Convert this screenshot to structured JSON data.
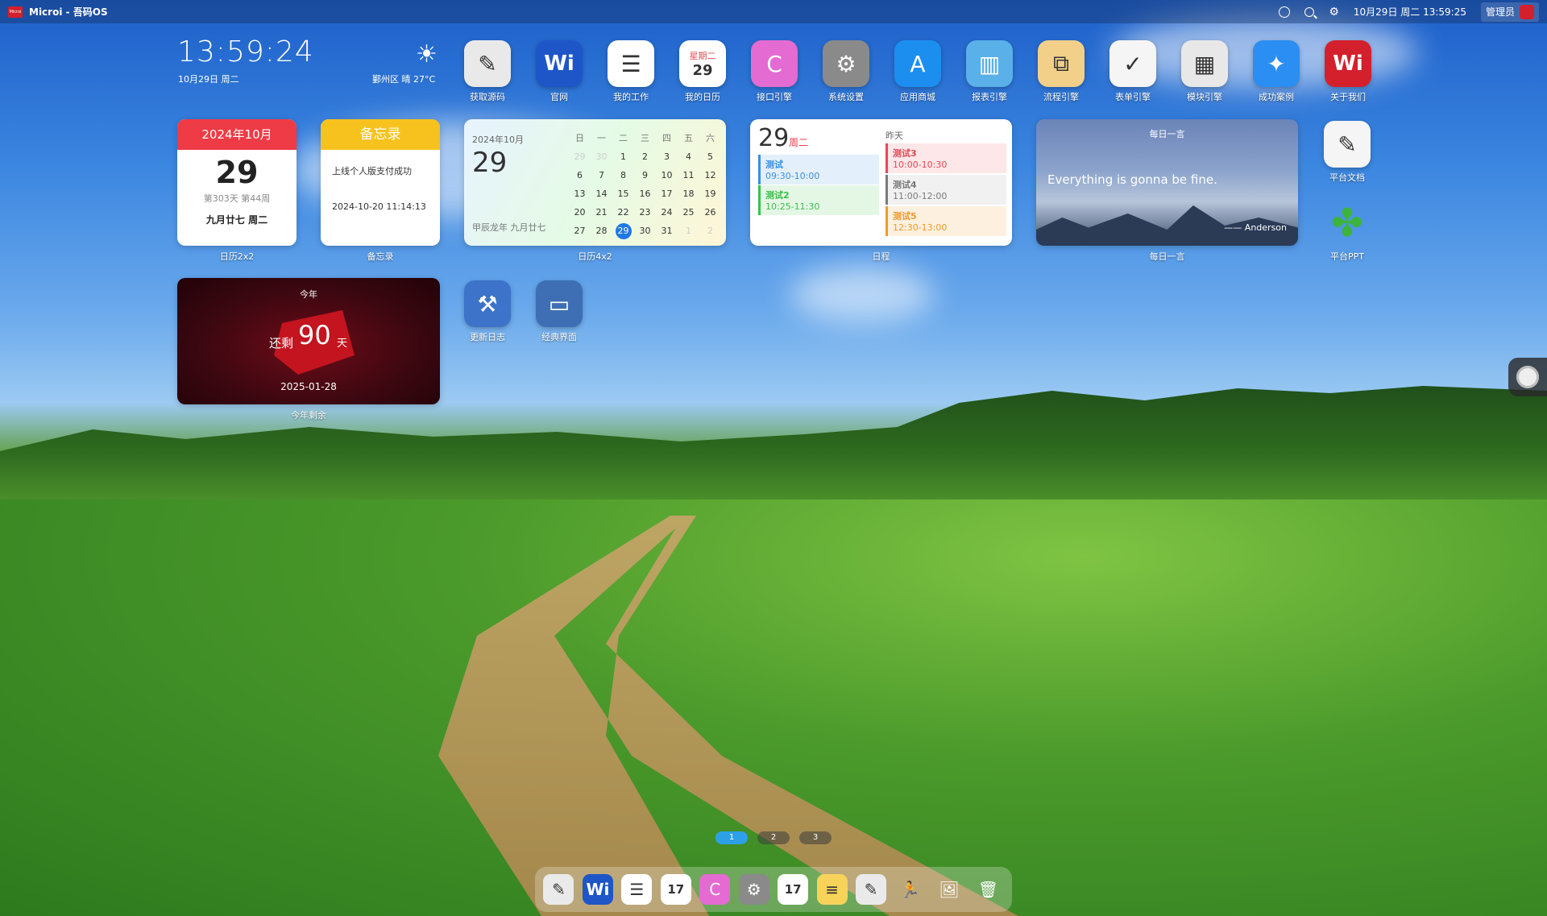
{
  "menubar": {
    "app_title": "Microi - 吾码OS",
    "datetime": "10月29日 周二 13:59:25",
    "user": "管理员"
  },
  "clock": {
    "time": "13:59:24",
    "date": "10月29日 周二"
  },
  "weather": {
    "text": "鄞州区 晴 27°C",
    "icon": "sun-icon"
  },
  "desktop_icons": [
    {
      "label": "获取源码",
      "icon": "pen-icon",
      "color": "#e9e9e9"
    },
    {
      "label": "官网",
      "icon": "wi-logo-icon",
      "color": "#1e56c8"
    },
    {
      "label": "我的工作",
      "icon": "list-icon",
      "color": "#ffffff"
    },
    {
      "label": "我的日历",
      "icon": "calendar-icon",
      "color": "#ffffff",
      "cal_weekday": "星期二",
      "cal_day": "29"
    },
    {
      "label": "接口引擎",
      "icon": "api-icon",
      "color": "#e36bd1"
    },
    {
      "label": "系统设置",
      "icon": "gear-icon",
      "color": "#8a8a8a"
    },
    {
      "label": "应用商城",
      "icon": "appstore-icon",
      "color": "#1b8ef0"
    },
    {
      "label": "报表引擎",
      "icon": "report-icon",
      "color": "#5ab0e8"
    },
    {
      "label": "流程引擎",
      "icon": "flow-icon",
      "color": "#f2d08a"
    },
    {
      "label": "表单引擎",
      "icon": "form-icon",
      "color": "#f5f5f5"
    },
    {
      "label": "模块引擎",
      "icon": "grid-icon",
      "color": "#e8e8e8"
    },
    {
      "label": "成功案例",
      "icon": "compass-icon",
      "color": "#2a8ef2"
    },
    {
      "label": "关于我们",
      "icon": "wi-logo-icon",
      "color": "#d4202c"
    }
  ],
  "side_icons": [
    {
      "label": "平台文档",
      "icon": "doc-icon",
      "color": "#f5f5f5"
    },
    {
      "label": "平台PPT",
      "icon": "clover-icon",
      "color": "transparent"
    }
  ],
  "row_icons": [
    {
      "label": "更新日志",
      "icon": "xcode-icon",
      "color": "#3d73c9"
    },
    {
      "label": "经典界面",
      "icon": "window-icon",
      "color": "#3e6fb5"
    }
  ],
  "widgets": {
    "cal2x2": {
      "month": "2024年10月",
      "day": "29",
      "sub": "第303天 第44周",
      "lunar": "九月廿七 周二",
      "label": "日历2x2"
    },
    "memo": {
      "header": "备忘录",
      "text": "上线个人版支付成功",
      "time": "2024-10-20 11:14:13",
      "label": "备忘录"
    },
    "cal4x2": {
      "ym": "2024年10月",
      "day": "29",
      "lunar": "甲辰龙年 九月廿七",
      "label": "日历4x2",
      "weekdays": [
        "日",
        "一",
        "二",
        "三",
        "四",
        "五",
        "六"
      ],
      "weeks": [
        [
          "29",
          "30",
          "1",
          "2",
          "3",
          "4",
          "5"
        ],
        [
          "6",
          "7",
          "8",
          "9",
          "10",
          "11",
          "12"
        ],
        [
          "13",
          "14",
          "15",
          "16",
          "17",
          "18",
          "19"
        ],
        [
          "20",
          "21",
          "22",
          "23",
          "24",
          "25",
          "26"
        ],
        [
          "27",
          "28",
          "29",
          "30",
          "31",
          "1",
          "2"
        ]
      ]
    },
    "schedule": {
      "day": "29",
      "weekday": "周二",
      "yesterday": "昨天",
      "label": "日程",
      "events": [
        {
          "title": "测试",
          "time": "09:30-10:00",
          "color": "#3a8fe0",
          "bg": "#e3f0fc"
        },
        {
          "title": "测试2",
          "time": "10:25-11:30",
          "color": "#3cbf4a",
          "bg": "#e4f7e5"
        },
        {
          "title": "测试3",
          "time": "10:00-10:30",
          "color": "#e04b55",
          "bg": "#fde7e8"
        },
        {
          "title": "测试4",
          "time": "11:00-12:00",
          "color": "#7a7a7a",
          "bg": "#f1f1f1"
        },
        {
          "title": "测试5",
          "time": "12:30-13:00",
          "color": "#f09a2a",
          "bg": "#fdf0df"
        }
      ]
    },
    "quote": {
      "title": "每日一言",
      "text": "Everything is gonna be fine.",
      "author": "—— Anderson",
      "label": "每日一言"
    },
    "remain": {
      "title": "今年",
      "prefix": "还剩",
      "days": "90",
      "unit": "天",
      "date": "2025-01-28",
      "label": "今年剩余"
    }
  },
  "pager": [
    "1",
    "2",
    "3"
  ],
  "dock": [
    {
      "icon": "pen-icon",
      "color": "#eaeaea"
    },
    {
      "icon": "wi-logo-icon",
      "color": "#1e56c8"
    },
    {
      "icon": "list-icon",
      "color": "#ffffff"
    },
    {
      "icon": "calendar-icon",
      "color": "#ffffff",
      "text": "17"
    },
    {
      "icon": "api-icon",
      "color": "#e36bd1"
    },
    {
      "icon": "gear-icon",
      "color": "#8a8a8a"
    },
    {
      "icon": "calendar-icon",
      "color": "#ffffff",
      "text": "17"
    },
    {
      "icon": "notes-icon",
      "color": "#f7d35a"
    },
    {
      "icon": "pen-icon",
      "color": "#eaeaea"
    },
    {
      "icon": "runner-icon",
      "color": "transparent"
    },
    {
      "icon": "photos-icon",
      "color": "transparent"
    },
    {
      "icon": "trash-icon",
      "color": "transparent"
    }
  ]
}
